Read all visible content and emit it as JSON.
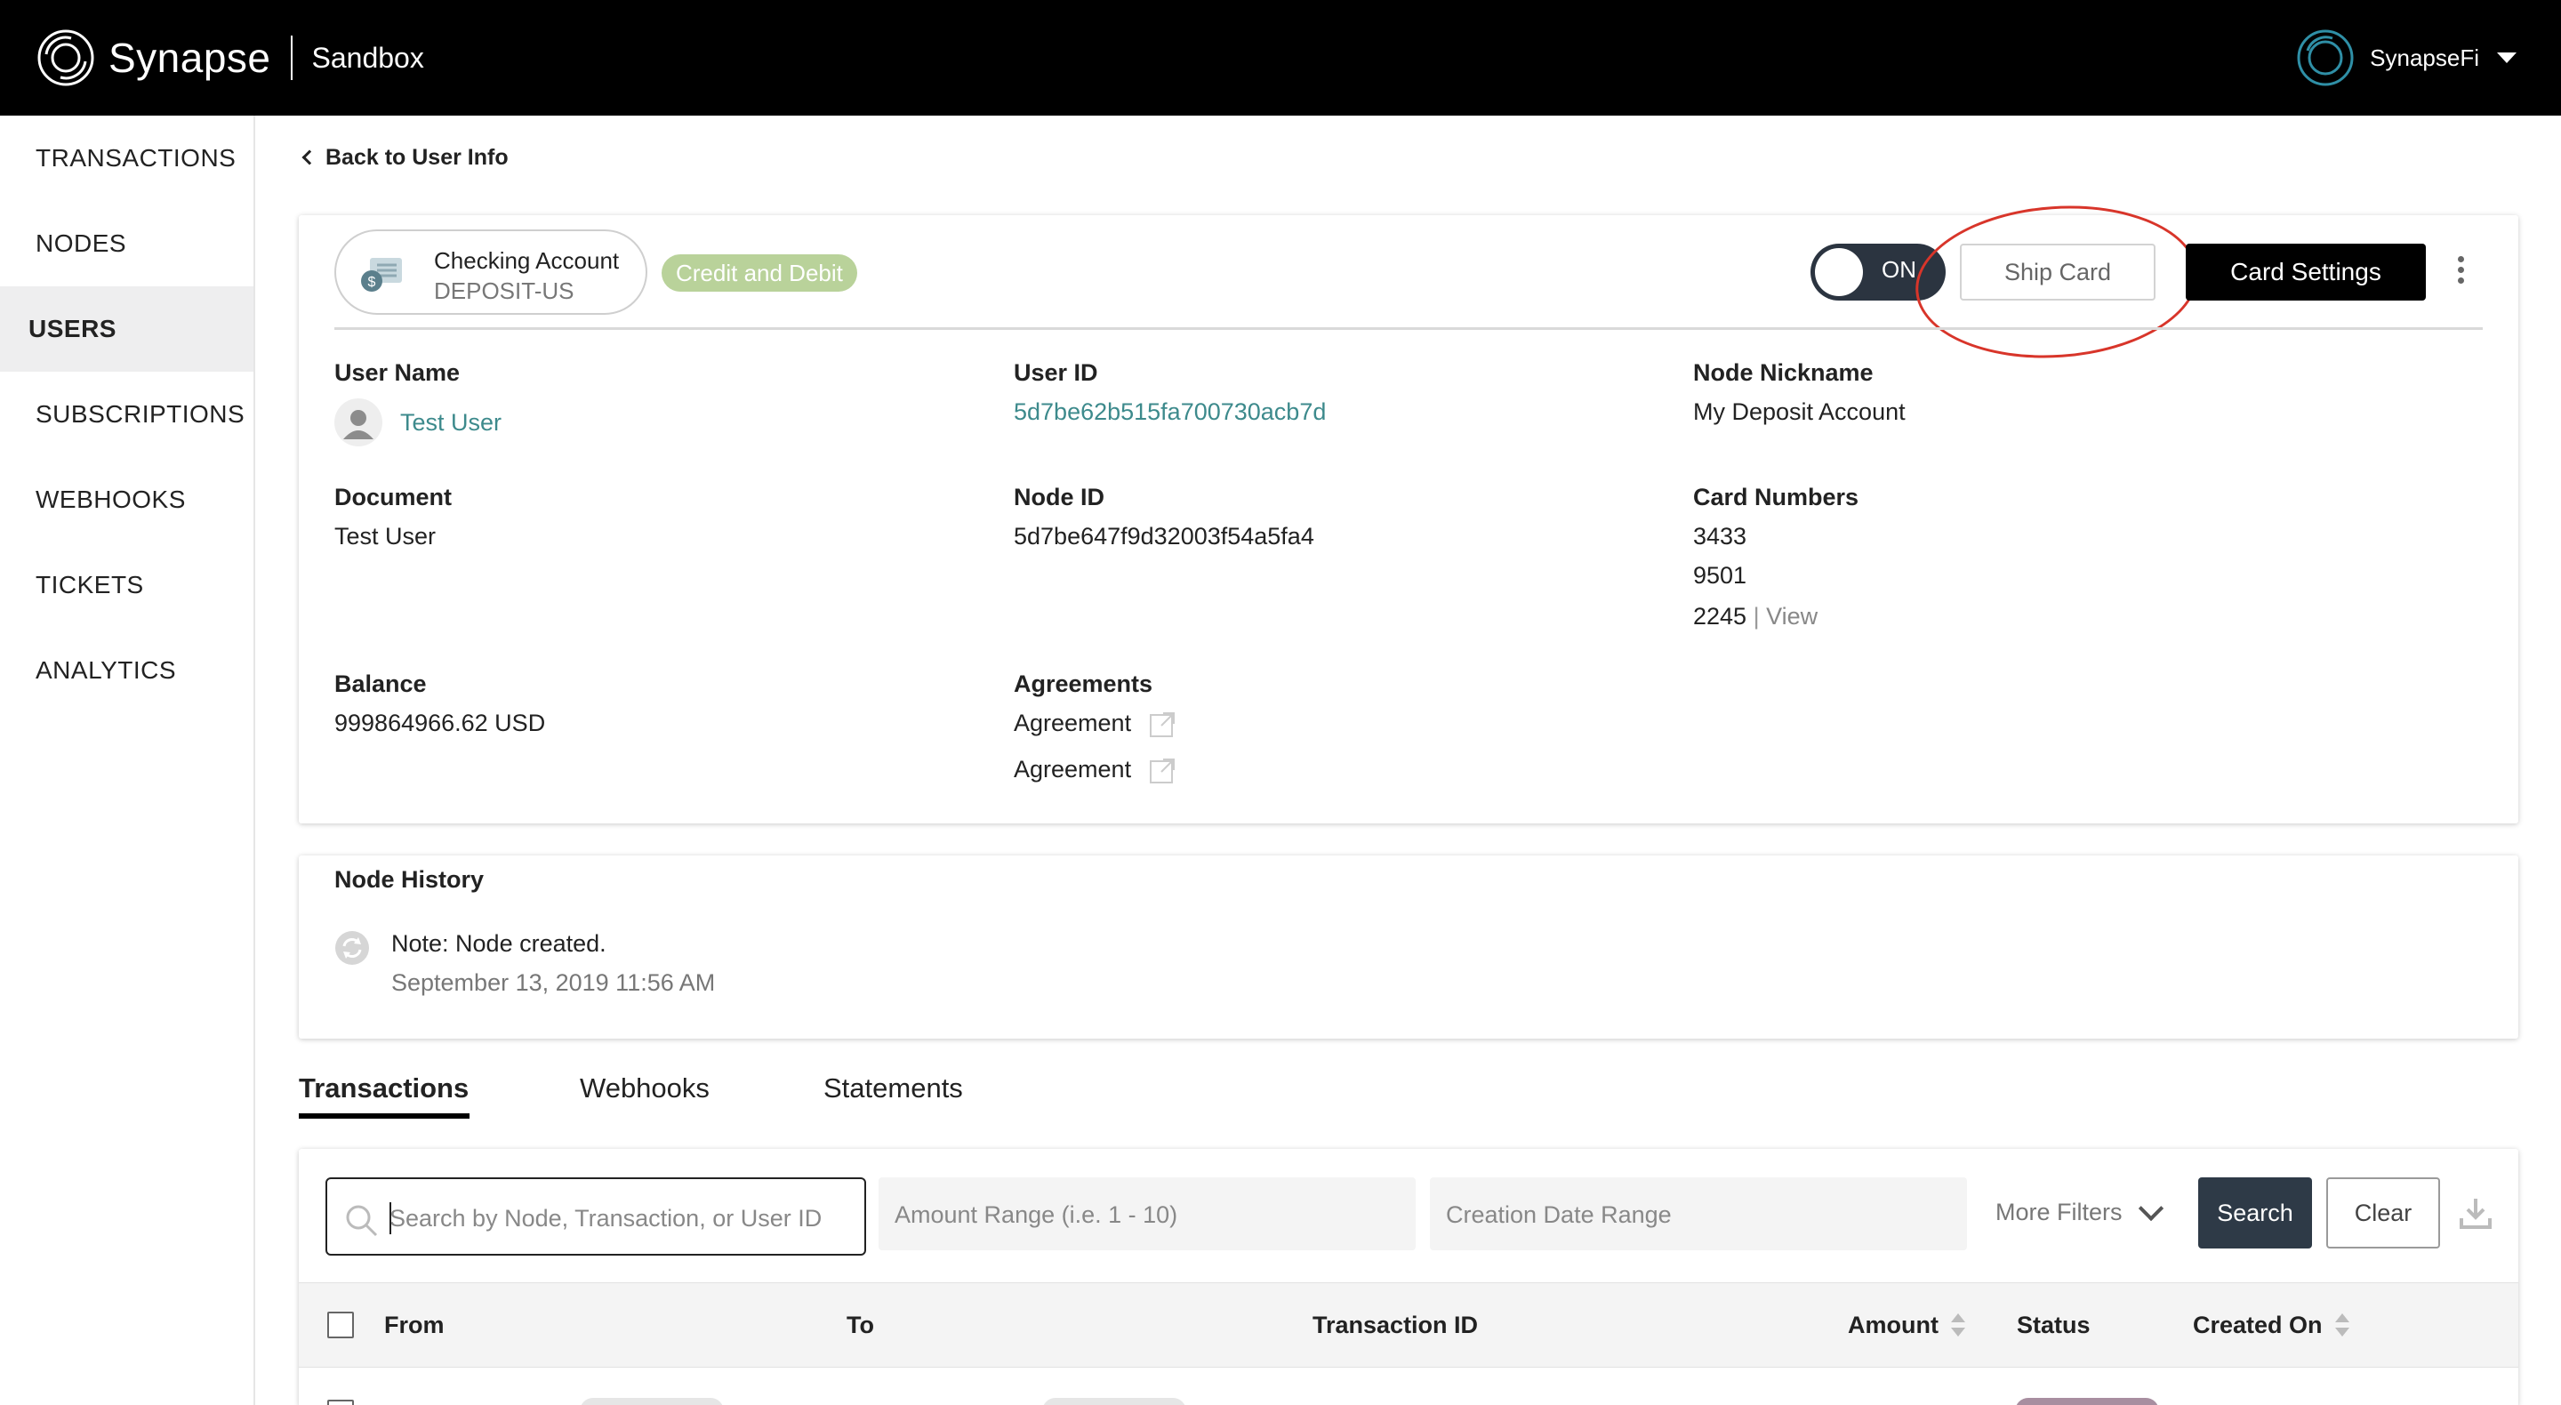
{
  "header": {
    "brand_name": "Synapse",
    "environment": "Sandbox",
    "account_name": "SynapseFi"
  },
  "sidebar": {
    "items": [
      {
        "label": "TRANSACTIONS",
        "active": false
      },
      {
        "label": "NODES",
        "active": false
      },
      {
        "label": "USERS",
        "active": true
      },
      {
        "label": "SUBSCRIPTIONS",
        "active": false
      },
      {
        "label": "WEBHOOKS",
        "active": false
      },
      {
        "label": "TICKETS",
        "active": false
      },
      {
        "label": "ANALYTICS",
        "active": false
      }
    ]
  },
  "main": {
    "back_link": "Back to User Info",
    "node_card": {
      "account_type": "Checking Account",
      "account_subtype": "DEPOSIT-US",
      "card_type_badge": "Credit and Debit",
      "toggle_label": "ON",
      "ship_card_label": "Ship Card",
      "card_settings_label": "Card Settings",
      "fields": {
        "user_name_label": "User Name",
        "user_name_value": "Test User",
        "user_id_label": "User ID",
        "user_id_value": "5d7be62b515fa700730acb7d",
        "node_nickname_label": "Node Nickname",
        "node_nickname_value": "My Deposit Account",
        "document_label": "Document",
        "document_value": "Test User",
        "node_id_label": "Node ID",
        "node_id_value": "5d7be647f9d32003f54a5fa4",
        "card_numbers_label": "Card Numbers",
        "card_numbers": [
          "3433",
          "9501",
          "2245"
        ],
        "card_separator": "|",
        "card_view_link": "View",
        "balance_label": "Balance",
        "balance_value": "999864966.62 USD",
        "agreements_label": "Agreements",
        "agreements": [
          "Agreement",
          "Agreement"
        ]
      }
    },
    "node_history": {
      "title": "Node History",
      "note": "Note: Node created.",
      "date": "September 13, 2019 11:56 AM"
    },
    "tabs": [
      {
        "label": "Transactions",
        "active": true
      },
      {
        "label": "Webhooks",
        "active": false
      },
      {
        "label": "Statements",
        "active": false
      }
    ],
    "filters": {
      "search_placeholder": "Search by Node, Transaction, or User ID",
      "amount_placeholder": "Amount Range (i.e. 1 - 10)",
      "date_placeholder": "Creation Date Range",
      "more_filters_label": "More Filters",
      "search_button": "Search",
      "clear_button": "Clear"
    },
    "table": {
      "columns": [
        "From",
        "To",
        "Transaction ID",
        "Amount",
        "Status",
        "Created On"
      ]
    }
  },
  "colors": {
    "topbar": "#000000",
    "accent_link": "#3d8a8c",
    "badge_green": "#b9d29a",
    "annotation_red": "#d8352a",
    "search_button": "#2e3a47"
  }
}
